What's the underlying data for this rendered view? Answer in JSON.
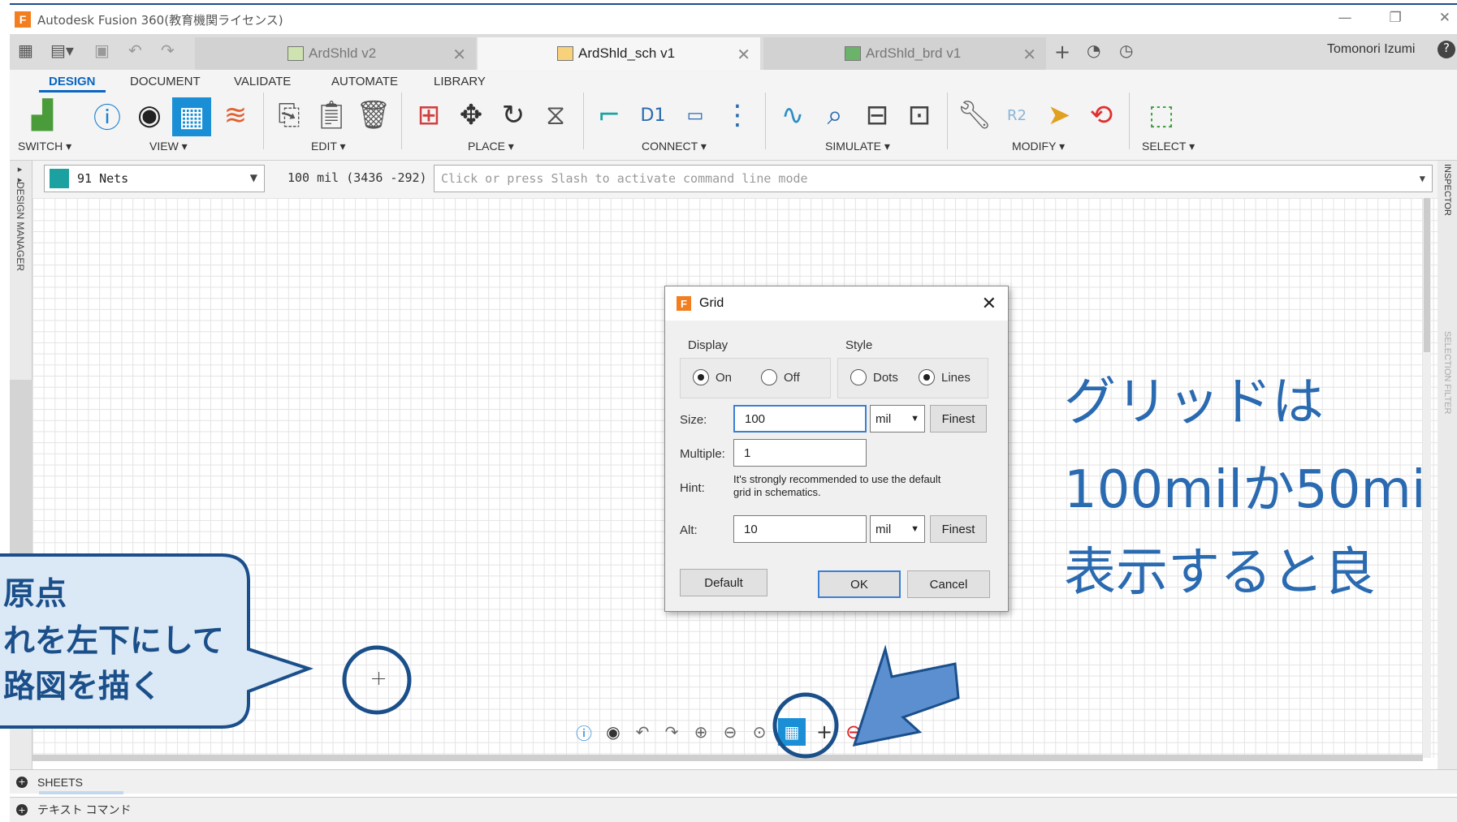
{
  "window": {
    "title": "Autodesk Fusion 360(教育機関ライセンス)",
    "logo_letter": "F",
    "controls": {
      "minimize": "—",
      "restore": "❐",
      "close": "✕"
    }
  },
  "tabs": [
    {
      "label": "ArdShld v2",
      "active": false
    },
    {
      "label": "ArdShld_sch v1",
      "active": true
    },
    {
      "label": "ArdShld_brd v1",
      "active": false
    }
  ],
  "tab_close": "✕",
  "user_name": "Tomonori Izumi",
  "ribbon": {
    "tabs": [
      "DESIGN",
      "DOCUMENT",
      "VALIDATE",
      "AUTOMATE",
      "LIBRARY"
    ],
    "groups": [
      "SWITCH ▾",
      "VIEW ▾",
      "EDIT ▾",
      "PLACE ▾",
      "CONNECT ▾",
      "SIMULATE ▾",
      "MODIFY ▾",
      "SELECT ▾"
    ]
  },
  "command_row": {
    "net_label": "91 Nets",
    "net_color": "#1ba2a0",
    "coord": "100 mil (3436 -292)",
    "command_placeholder": "Click or press Slash to activate command line mode"
  },
  "side": {
    "left_panel": "DESIGN MANAGER",
    "right_panel_top": "INSPECTOR",
    "right_panel_mid": "SELECTION FILTER"
  },
  "bottom": {
    "sheets": "SHEETS",
    "text_command": "テキスト コマンド"
  },
  "dialog": {
    "title": "Grid",
    "display_label": "Display",
    "style_label": "Style",
    "display_options": [
      {
        "label": "On",
        "checked": true
      },
      {
        "label": "Off",
        "checked": false
      }
    ],
    "style_options": [
      {
        "label": "Dots",
        "checked": false
      },
      {
        "label": "Lines",
        "checked": true
      }
    ],
    "size_label": "Size:",
    "size_value": "100",
    "size_unit": "mil",
    "finest_label": "Finest",
    "multiple_label": "Multiple:",
    "multiple_value": "1",
    "hint_label": "Hint:",
    "hint_text": "It's strongly recommended to use the default grid in schematics.",
    "alt_label": "Alt:",
    "alt_value": "10",
    "alt_unit": "mil",
    "default_button": "Default",
    "ok_button": "OK",
    "cancel_button": "Cancel"
  },
  "annotations": {
    "callout_lines": [
      "原点",
      "れを左下にして",
      "路図を描く"
    ],
    "big_text_lines": [
      "グリッドは",
      "100milか50mi",
      "表示すると良"
    ],
    "accent_color": "#1a4f8a",
    "arrow_color": "#5b8fd0"
  }
}
